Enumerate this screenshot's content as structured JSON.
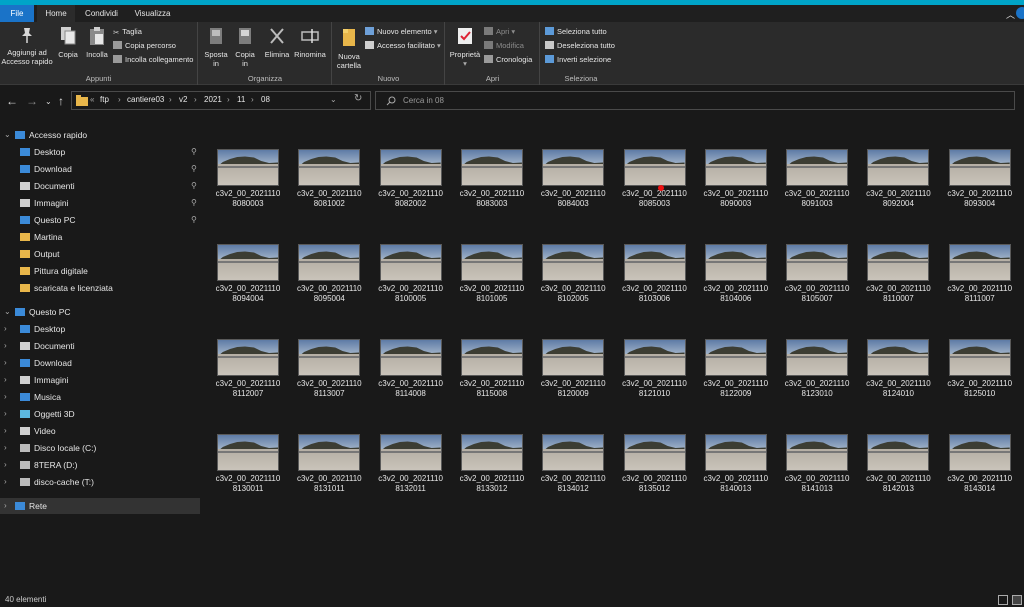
{
  "tabs": [
    {
      "label": "File"
    },
    {
      "label": "Home"
    },
    {
      "label": "Condividi"
    },
    {
      "label": "Visualizza"
    }
  ],
  "ribbon": {
    "appunti": {
      "label": "Appunti",
      "pin_label": "Aggiungi ad Accesso rapido",
      "copy_label": "Copia",
      "paste_label": "Incolla",
      "cut_label": "Taglia",
      "copy_path_label": "Copia percorso",
      "paste_shortcut_label": "Incolla collegamento"
    },
    "organizza": {
      "label": "Organizza",
      "move_label": "Sposta in",
      "copyto_label": "Copia in",
      "delete_label": "Elimina",
      "rename_label": "Rinomina"
    },
    "nuovo": {
      "label": "Nuovo",
      "new_folder_label": "Nuova cartella",
      "new_item_label": "Nuovo elemento",
      "easy_access_label": "Accesso facilitato"
    },
    "apri": {
      "label": "Apri",
      "properties_label": "Proprietà",
      "open_label": "Apri",
      "edit_label": "Modifica",
      "history_label": "Cronologia"
    },
    "seleziona": {
      "label": "Seleziona",
      "select_all_label": "Seleziona tutto",
      "select_none_label": "Deseleziona tutto",
      "invert_label": "Inverti selezione"
    }
  },
  "address": {
    "prefix": "«",
    "crumbs": [
      "ftp",
      "cantiere03",
      "v2",
      "2021",
      "11",
      "08"
    ],
    "search_placeholder": "Cerca in 08"
  },
  "sidebar": {
    "quick_access": "Accesso rapido",
    "quick_items": [
      {
        "label": "Desktop",
        "icon": "desktop-icon",
        "pinned": true
      },
      {
        "label": "Download",
        "icon": "download-icon",
        "pinned": true
      },
      {
        "label": "Documenti",
        "icon": "documents-icon",
        "pinned": true
      },
      {
        "label": "Immagini",
        "icon": "images-icon",
        "pinned": true
      },
      {
        "label": "Questo PC",
        "icon": "computer-icon",
        "pinned": true
      },
      {
        "label": "Martina",
        "icon": "folder-icon",
        "pinned": false
      },
      {
        "label": "Output",
        "icon": "folder-icon",
        "pinned": false
      },
      {
        "label": "Pittura digitale",
        "icon": "folder-icon",
        "pinned": false
      },
      {
        "label": "scaricata e licenziata",
        "icon": "folder-icon",
        "pinned": false
      }
    ],
    "this_pc": "Questo PC",
    "pc_items": [
      {
        "label": "Desktop",
        "icon": "desktop-icon"
      },
      {
        "label": "Documenti",
        "icon": "documents-icon"
      },
      {
        "label": "Download",
        "icon": "download-icon"
      },
      {
        "label": "Immagini",
        "icon": "images-icon"
      },
      {
        "label": "Musica",
        "icon": "music-icon"
      },
      {
        "label": "Oggetti 3D",
        "icon": "3d-objects-icon"
      },
      {
        "label": "Video",
        "icon": "video-icon"
      },
      {
        "label": "Disco locale (C:)",
        "icon": "disk-icon"
      },
      {
        "label": "8TERA (D:)",
        "icon": "drive-icon"
      },
      {
        "label": "disco-cache (T:)",
        "icon": "drive-icon"
      }
    ],
    "network": "Rete"
  },
  "files": [
    {
      "l1": "c3v2_00_2021110",
      "l2": "8080003"
    },
    {
      "l1": "c3v2_00_2021110",
      "l2": "8081002"
    },
    {
      "l1": "c3v2_00_2021110",
      "l2": "8082002"
    },
    {
      "l1": "c3v2_00_2021110",
      "l2": "8083003"
    },
    {
      "l1": "c3v2_00_2021110",
      "l2": "8084003"
    },
    {
      "l1": "c3v2_00_2021110",
      "l2": "8085003"
    },
    {
      "l1": "c3v2_00_2021110",
      "l2": "8090003"
    },
    {
      "l1": "c3v2_00_2021110",
      "l2": "8091003"
    },
    {
      "l1": "c3v2_00_2021110",
      "l2": "8092004"
    },
    {
      "l1": "c3v2_00_2021110",
      "l2": "8093004"
    },
    {
      "l1": "c3v2_00_2021110",
      "l2": "8094004"
    },
    {
      "l1": "c3v2_00_2021110",
      "l2": "8095004"
    },
    {
      "l1": "c3v2_00_2021110",
      "l2": "8100005"
    },
    {
      "l1": "c3v2_00_2021110",
      "l2": "8101005"
    },
    {
      "l1": "c3v2_00_2021110",
      "l2": "8102005"
    },
    {
      "l1": "c3v2_00_2021110",
      "l2": "8103006"
    },
    {
      "l1": "c3v2_00_2021110",
      "l2": "8104006"
    },
    {
      "l1": "c3v2_00_2021110",
      "l2": "8105007"
    },
    {
      "l1": "c3v2_00_2021110",
      "l2": "8110007"
    },
    {
      "l1": "c3v2_00_2021110",
      "l2": "8111007"
    },
    {
      "l1": "c3v2_00_2021110",
      "l2": "8112007"
    },
    {
      "l1": "c3v2_00_2021110",
      "l2": "8113007"
    },
    {
      "l1": "c3v2_00_2021110",
      "l2": "8114008"
    },
    {
      "l1": "c3v2_00_2021110",
      "l2": "8115008"
    },
    {
      "l1": "c3v2_00_2021110",
      "l2": "8120009"
    },
    {
      "l1": "c3v2_00_2021110",
      "l2": "8121010"
    },
    {
      "l1": "c3v2_00_2021110",
      "l2": "8122009"
    },
    {
      "l1": "c3v2_00_2021110",
      "l2": "8123010"
    },
    {
      "l1": "c3v2_00_2021110",
      "l2": "8124010"
    },
    {
      "l1": "c3v2_00_2021110",
      "l2": "8125010"
    },
    {
      "l1": "c3v2_00_2021110",
      "l2": "8130011"
    },
    {
      "l1": "c3v2_00_2021110",
      "l2": "8131011"
    },
    {
      "l1": "c3v2_00_2021110",
      "l2": "8132011"
    },
    {
      "l1": "c3v2_00_2021110",
      "l2": "8133012"
    },
    {
      "l1": "c3v2_00_2021110",
      "l2": "8134012"
    },
    {
      "l1": "c3v2_00_2021110",
      "l2": "8135012"
    },
    {
      "l1": "c3v2_00_2021110",
      "l2": "8140013"
    },
    {
      "l1": "c3v2_00_2021110",
      "l2": "8141013"
    },
    {
      "l1": "c3v2_00_2021110",
      "l2": "8142013"
    },
    {
      "l1": "c3v2_00_2021110",
      "l2": "8143014"
    }
  ],
  "status": {
    "count": "40 elementi"
  },
  "colors": {
    "accent": "#00a4c8",
    "file_tab": "#1a73c8",
    "background": "#191919"
  }
}
